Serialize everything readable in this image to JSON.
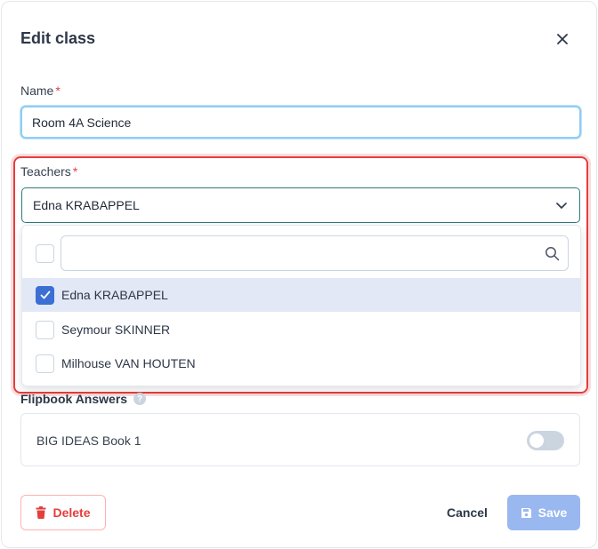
{
  "dialog": {
    "title": "Edit class",
    "close_icon": "close-icon"
  },
  "name_field": {
    "label": "Name",
    "required_mark": "*",
    "value": "Room 4A Science"
  },
  "teachers_field": {
    "label": "Teachers",
    "required_mark": "*",
    "selected_value": "Edna KRABAPPEL",
    "search_placeholder": "",
    "options": [
      {
        "label": "Edna KRABAPPEL",
        "checked": true
      },
      {
        "label": "Seymour SKINNER",
        "checked": false
      },
      {
        "label": "Milhouse VAN HOUTEN",
        "checked": false
      }
    ]
  },
  "flipbook": {
    "title": "Flipbook Answers",
    "help_icon": "?",
    "book_name": "BIG IDEAS Book 1",
    "enabled": false
  },
  "footer": {
    "delete_label": "Delete",
    "cancel_label": "Cancel",
    "save_label": "Save"
  },
  "colors": {
    "primary": "#3b6fd4",
    "save_disabled": "#9ab8f0",
    "danger": "#e53e3e",
    "focus_ring": "#90cdf4",
    "selected_row": "#e2e8f6"
  }
}
